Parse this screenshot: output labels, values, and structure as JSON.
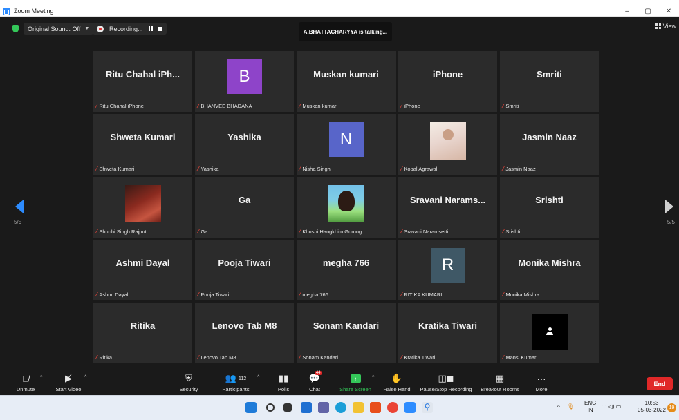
{
  "window": {
    "title": "Zoom Meeting",
    "controls": [
      "–",
      "▢",
      "✕"
    ]
  },
  "topbar": {
    "original_sound": "Original Sound: Off",
    "recording": "Recording...",
    "talking": "A.BHATTACHARYYA is talking...",
    "view": "View"
  },
  "pagination": {
    "left": "5/5",
    "right": "5/5"
  },
  "tiles": [
    {
      "big": "Ritu Chahal iPh...",
      "label": "Ritu Chahal iPhone"
    },
    {
      "letter": "B",
      "color": "#8e44c9",
      "label": "BHANVEE BHADANA"
    },
    {
      "big": "Muskan kumari",
      "label": "Muskan kumari"
    },
    {
      "big": "iPhone",
      "label": "iPhone"
    },
    {
      "big": "Smriti",
      "label": "Smriti"
    },
    {
      "big": "Shweta Kumari",
      "label": "Shweta Kumari"
    },
    {
      "big": "Yashika",
      "label": "Yashika"
    },
    {
      "letter": "N",
      "color": "#5865c9",
      "label": "Nisha Singh"
    },
    {
      "photo": "girl",
      "label": "Kopal Agrawal"
    },
    {
      "big": "Jasmin Naaz",
      "label": "Jasmin Naaz"
    },
    {
      "photo": "red",
      "label": "Shubhi Singh Rajput"
    },
    {
      "big": "Ga",
      "label": "Ga"
    },
    {
      "photo": "cartoon",
      "label": "Khushi Hangkhim Gurung"
    },
    {
      "big": "Sravani Narams...",
      "label": "Sravani Naramsetti"
    },
    {
      "big": "Srishti",
      "label": "Srishti"
    },
    {
      "big": "Ashmi Dayal",
      "label": "Ashmi Dayal"
    },
    {
      "big": "Pooja Tiwari",
      "label": "Pooja Tiwari"
    },
    {
      "big": "megha 766",
      "label": "megha 766"
    },
    {
      "letter": "R",
      "color": "#3f5866",
      "label": "RITIKA KUMARI"
    },
    {
      "big": "Monika Mishra",
      "label": "Monika Mishra"
    },
    {
      "big": "Ritika",
      "label": "Ritika"
    },
    {
      "big": "Lenovo Tab M8",
      "label": "Lenovo Tab M8"
    },
    {
      "big": "Sonam Kandari",
      "label": "Sonam Kandari"
    },
    {
      "big": "Kratika Tiwari",
      "label": "Kratika Tiwari"
    },
    {
      "blackbox": true,
      "label": "Mansi Kumar"
    }
  ],
  "toolbar": {
    "unmute": "Unmute",
    "start_video": "Start Video",
    "security": "Security",
    "participants": "Participants",
    "participants_count": "112",
    "polls": "Polls",
    "chat": "Chat",
    "chat_badge": "44",
    "share_screen": "Share Screen",
    "raise_hand": "Raise Hand",
    "pause_stop_recording": "Pause/Stop Recording",
    "breakout_rooms": "Breakout Rooms",
    "more": "More",
    "end": "End"
  },
  "taskbar": {
    "lang_line1": "ENG",
    "lang_line2": "IN",
    "time": "10:53",
    "date": "05-03-2022",
    "notifications": "19"
  }
}
